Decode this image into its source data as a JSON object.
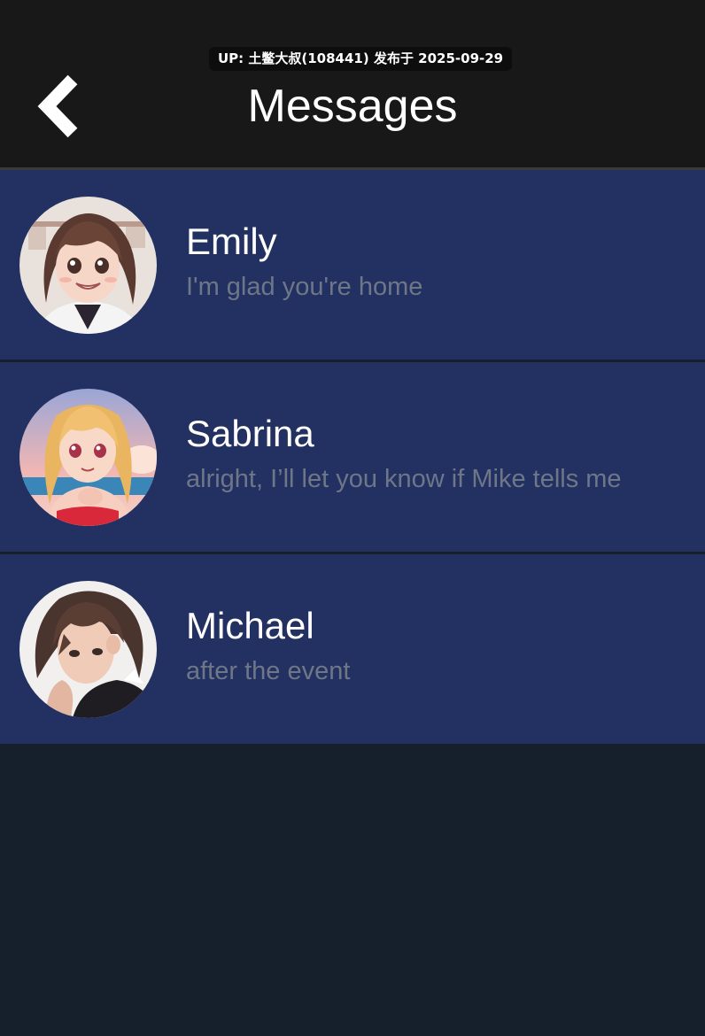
{
  "watermark": "UP: 土鳖大叔(108441) 发布于 2025-09-29",
  "header": {
    "title": "Messages",
    "back_icon": "chevron-left-icon"
  },
  "colors": {
    "header_bg": "#181818",
    "row_bg": "#223161",
    "page_bg": "#161f2c",
    "name_text": "#ffffff",
    "preview_text": "#6e7687"
  },
  "conversations": [
    {
      "name": "Emily",
      "preview": "I'm glad you're home"
    },
    {
      "name": "Sabrina",
      "preview": "alright, I’ll let you know if Mike tells me"
    },
    {
      "name": "Michael",
      "preview": "after the event"
    }
  ]
}
